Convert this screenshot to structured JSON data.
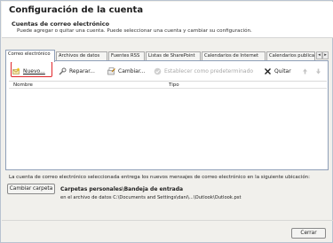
{
  "window": {
    "title": "Configuración de la cuenta"
  },
  "header": {
    "section_title": "Cuentas de correo electrónico",
    "section_desc": "Puede agregar o quitar una cuenta. Puede seleccionar una cuenta y cambiar su configuración."
  },
  "tabs": [
    {
      "label": "Correo electrónico",
      "active": true
    },
    {
      "label": "Archivos de datos"
    },
    {
      "label": "Fuentes RSS"
    },
    {
      "label": "Listas de SharePoint"
    },
    {
      "label": "Calendarios de Internet"
    },
    {
      "label": "Calendarios publicac"
    }
  ],
  "tab_scroll": {
    "left": "◂",
    "right": "▸"
  },
  "toolbar": {
    "new_label": "Nuevo...",
    "repair_label": "Reparar...",
    "change_label": "Cambiar...",
    "default_label": "Establecer como predeterminado",
    "remove_label": "Quitar",
    "up_icon": "up-arrow-icon",
    "down_icon": "down-arrow-icon"
  },
  "list": {
    "columns": [
      "Nombre",
      "Tipo"
    ]
  },
  "delivery": {
    "description": "La cuenta de correo electrónico seleccionada entrega los nuevos mensajes de correo electrónico en la siguiente ubicación:",
    "change_folder_label": "Cambiar carpeta",
    "folder_name": "Carpetas personales\\Bandeja de entrada",
    "folder_path": "en el archivo de datos C:\\Documents and Settings\\dani\\...\\Outlook\\Outlook.pst"
  },
  "footer": {
    "close_label": "Cerrar"
  },
  "colors": {
    "highlight": "#e0262a",
    "accent_blue": "#2b5ea8"
  }
}
